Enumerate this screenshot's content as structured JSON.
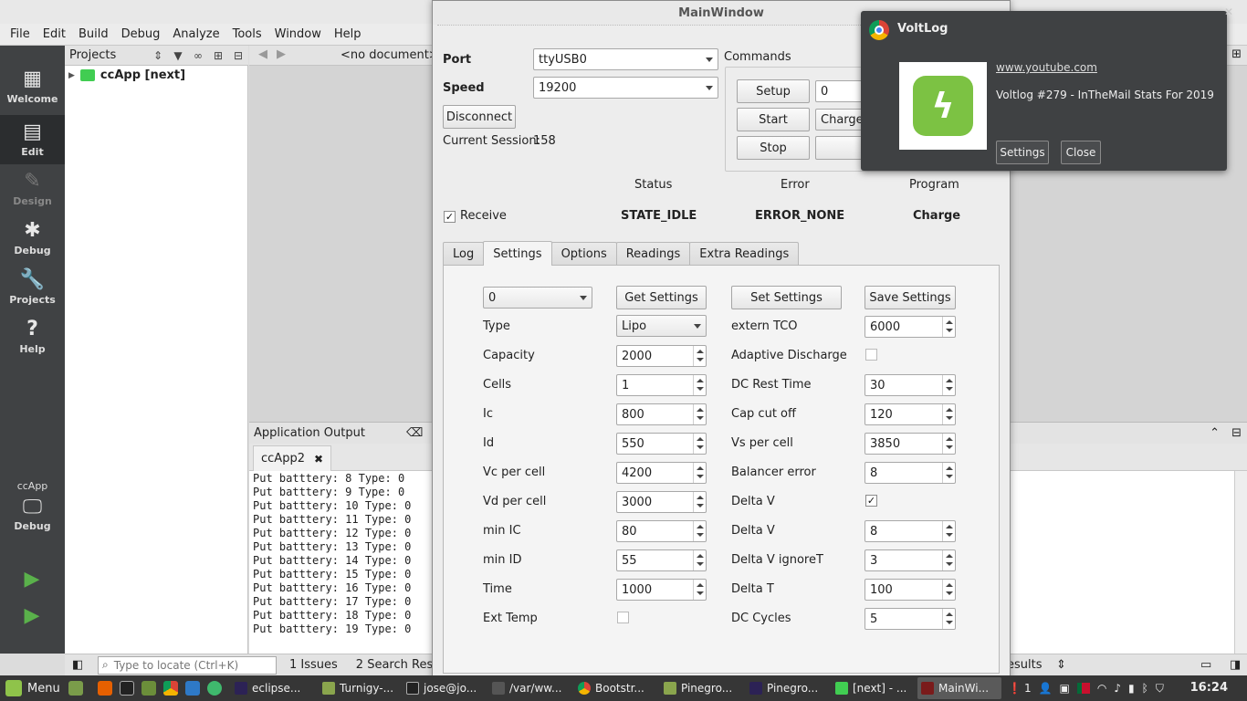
{
  "ide": {
    "menu": [
      "File",
      "Edit",
      "Build",
      "Debug",
      "Analyze",
      "Tools",
      "Window",
      "Help"
    ],
    "modes": {
      "welcome": "Welcome",
      "edit": "Edit",
      "design": "Design",
      "debug": "Debug",
      "projects": "Projects",
      "help": "Help"
    },
    "kit_project": "ccApp",
    "kit_config": "Debug",
    "projects_header": "Projects",
    "tree_root": "ccApp [next]",
    "no_document": "<no document>",
    "app_output_title": "Application Output",
    "output_tab": "ccApp2",
    "output_tab_close": "✖",
    "output_lines": [
      "Put batttery: 8  Type: 0",
      "Put batttery: 9  Type: 0",
      "Put batttery: 10  Type: 0",
      "Put batttery: 11  Type: 0",
      "Put batttery: 12  Type: 0",
      "Put batttery: 13  Type: 0",
      "Put batttery: 14  Type: 0",
      "Put batttery: 15  Type: 0",
      "Put batttery: 16  Type: 0",
      "Put batttery: 17  Type: 0",
      "Put batttery: 18  Type: 0",
      "Put batttery: 19  Type: 0"
    ],
    "locator_placeholder": "Type to locate (Ctrl+K)",
    "status_panes": [
      "1  Issues",
      "2  Search Results",
      "esults"
    ]
  },
  "mainwindow": {
    "title": "MainWindow",
    "port_label": "Port",
    "port_value": "ttyUSB0",
    "speed_label": "Speed",
    "speed_value": "19200",
    "disconnect": "Disconnect",
    "session_label": "Current Session:",
    "session_value": "158",
    "commands_title": "Commands",
    "setup": "Setup",
    "start": "Start",
    "stop": "Stop",
    "cmd_combo_value": "0",
    "program_combo_value": "Charge",
    "status_header": "Status",
    "error_header": "Error",
    "program_header": "Program",
    "receive_label": "Receive",
    "status_value": "STATE_IDLE",
    "error_value": "ERROR_NONE",
    "program_value": "Charge",
    "tabs": [
      "Log",
      "Settings",
      "Options",
      "Readings",
      "Extra Readings"
    ],
    "settings": {
      "slot_value": "0",
      "get_settings": "Get Settings",
      "set_settings": "Set Settings",
      "save_settings": "Save Settings",
      "type_label": "Type",
      "type_value": "Lipo",
      "extern_tco_label": "extern TCO",
      "extern_tco_value": "6000",
      "capacity_label": "Capacity",
      "capacity_value": "2000",
      "adaptive_discharge_label": "Adaptive Discharge",
      "cells_label": "Cells",
      "cells_value": "1",
      "dc_rest_time_label": "DC Rest Time",
      "dc_rest_time_value": "30",
      "ic_label": "Ic",
      "ic_value": "800",
      "cap_cut_off_label": "Cap cut off",
      "cap_cut_off_value": "120",
      "id_label": "Id",
      "id_value": "550",
      "vs_per_cell_label": "Vs per cell",
      "vs_per_cell_value": "3850",
      "vc_per_cell_label": "Vc per cell",
      "vc_per_cell_value": "4200",
      "balancer_error_label": "Balancer error",
      "balancer_error_value": "8",
      "vd_per_cell_label": "Vd per cell",
      "vd_per_cell_value": "3000",
      "delta_v_check_label": "Delta V",
      "min_ic_label": "min IC",
      "min_ic_value": "80",
      "delta_v_label": "Delta V",
      "delta_v_value": "8",
      "min_id_label": "min ID",
      "min_id_value": "55",
      "delta_v_ignore_label": "Delta V ignoreT",
      "delta_v_ignore_value": "3",
      "time_label": "Time",
      "time_value": "1000",
      "delta_t_label": "Delta T",
      "delta_t_value": "100",
      "ext_temp_label": "Ext Temp",
      "dc_cycles_label": "DC Cycles",
      "dc_cycles_value": "5"
    }
  },
  "notification": {
    "app": "VoltLog",
    "url": "www.youtube.com",
    "message": "Voltlog #279 - InTheMail Stats For 2019",
    "settings": "Settings",
    "close": "Close"
  },
  "taskbar": {
    "menu": "Menu",
    "tasks": [
      "eclipse...",
      "Turnigy-...",
      "jose@jo...",
      "/var/ww...",
      "Bootstr...",
      "Pinegro...",
      "Pinegro...",
      "[next] - ...",
      "MainWi..."
    ],
    "tray_count": "1",
    "clock": "16:24"
  },
  "colors": {
    "modebar": "#404244",
    "run_green": "#5ab14b",
    "voltlog_green": "#7cc243",
    "notification_bg": "#3f4143",
    "taskbar_bg": "#363636"
  }
}
